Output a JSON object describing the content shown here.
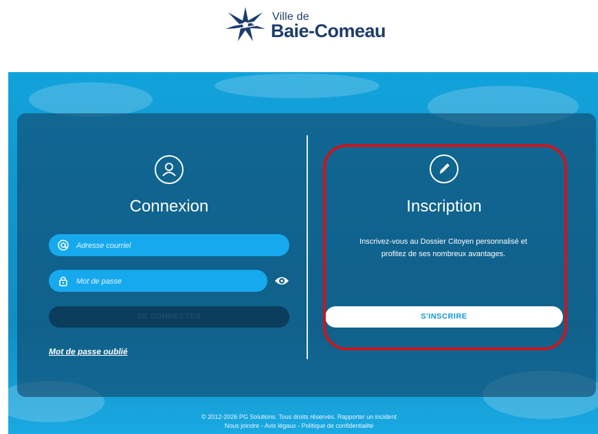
{
  "header": {
    "logo_small": "Ville de",
    "logo_big": "Baie-Comeau"
  },
  "login": {
    "title": "Connexion",
    "email_placeholder": "Adresse courriel",
    "password_placeholder": "Mot de passe",
    "submit_label": "SE CONNECTER",
    "forgot_label": "Mot de passe oublié"
  },
  "signup": {
    "title": "Inscription",
    "description": "Inscrivez-vous au Dossier Citoyen personnalisé et profitez de ses nombreux avantages.",
    "button_label": "S'INSCRIRE"
  },
  "footer": {
    "copyright": "© 2012-2026 PG Solutions. Tous droits réservés.",
    "report_link": "Rapporter un incident",
    "contact_link": "Nous joindre",
    "legal_link": "Avis légaux",
    "privacy_link": "Politique de confidentialité",
    "separator": " - "
  },
  "colors": {
    "brand_blue": "#1d3c6e",
    "input_blue": "#17a9ee",
    "highlight_red": "#d0131c"
  },
  "icons": [
    "city-logo-star-icon",
    "user-icon",
    "pencil-icon",
    "at-icon",
    "lock-icon",
    "eye-icon"
  ]
}
